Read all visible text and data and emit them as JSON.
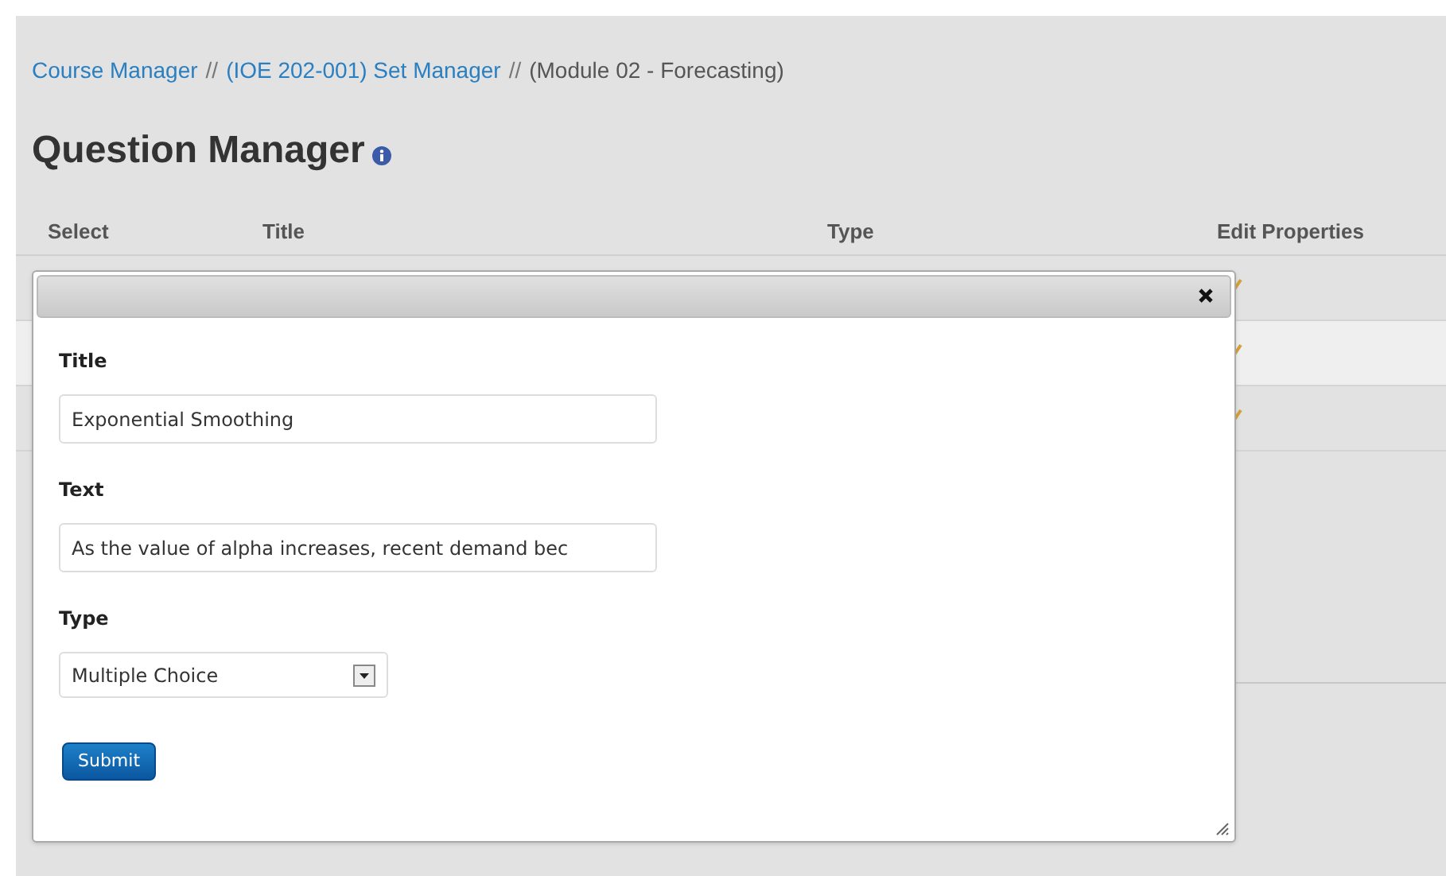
{
  "breadcrumb": [
    {
      "kind": "link",
      "text": "Course Manager"
    },
    {
      "kind": "separator",
      "text": "//"
    },
    {
      "kind": "link",
      "text": "(IOE 202-001) Set Manager"
    },
    {
      "kind": "separator",
      "text": "//"
    },
    {
      "kind": "current",
      "text": "(Module 02 - Forecasting)"
    }
  ],
  "heading": "Question Manager",
  "table": {
    "columns": [
      "Select",
      "Title",
      "Type",
      "Edit Properties"
    ],
    "rows": [
      {
        "highlighted": false
      },
      {
        "highlighted": true
      },
      {
        "highlighted": false
      }
    ]
  },
  "dialog": {
    "fields": [
      {
        "kind": "text",
        "label": "Title",
        "value": "Exponential Smoothing"
      },
      {
        "kind": "text",
        "label": "Text",
        "value": "As the value of alpha increases, recent demand bec"
      },
      {
        "kind": "select",
        "label": "Type",
        "value": "Multiple Choice"
      }
    ],
    "submit": "Submit"
  }
}
